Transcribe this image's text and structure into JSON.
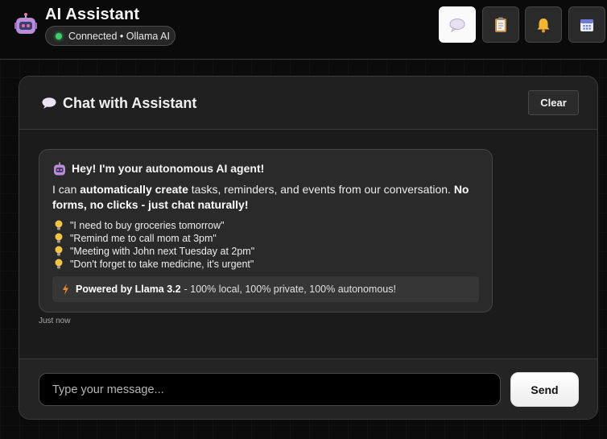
{
  "header": {
    "app_title": "AI Assistant",
    "status_text": "Connected • Ollama AI",
    "status_color": "#3ecf6a",
    "nav": [
      {
        "name": "chat",
        "icon": "speech-bubble-icon",
        "active": true
      },
      {
        "name": "notes",
        "icon": "clipboard-icon",
        "active": false
      },
      {
        "name": "reminders",
        "icon": "bell-icon",
        "active": false
      },
      {
        "name": "calendar",
        "icon": "calendar-icon",
        "active": false
      }
    ]
  },
  "chat": {
    "title": "Chat with Assistant",
    "clear_label": "Clear"
  },
  "message": {
    "title": "Hey! I'm your autonomous AI agent!",
    "intro_pre": "I can ",
    "intro_bold1": "automatically create",
    "intro_mid": " tasks, reminders, and events from our conversation. ",
    "intro_bold2": "No forms, no clicks - just chat naturally!",
    "examples": [
      "\"I need to buy groceries tomorrow\"",
      "\"Remind me to call mom at 3pm\"",
      "\"Meeting with John next Tuesday at 2pm\"",
      "\"Don't forget to take medicine, it's urgent\""
    ],
    "powered_bold": "Powered by Llama 3.2",
    "powered_rest": "- 100% local, 100% private, 100% autonomous!",
    "timestamp": "Just now"
  },
  "composer": {
    "placeholder": "Type your message...",
    "value": "",
    "send_label": "Send"
  },
  "colors": {
    "accent": "#ffffff",
    "background": "#0b0b0b",
    "panel": "#1b1b1b"
  }
}
